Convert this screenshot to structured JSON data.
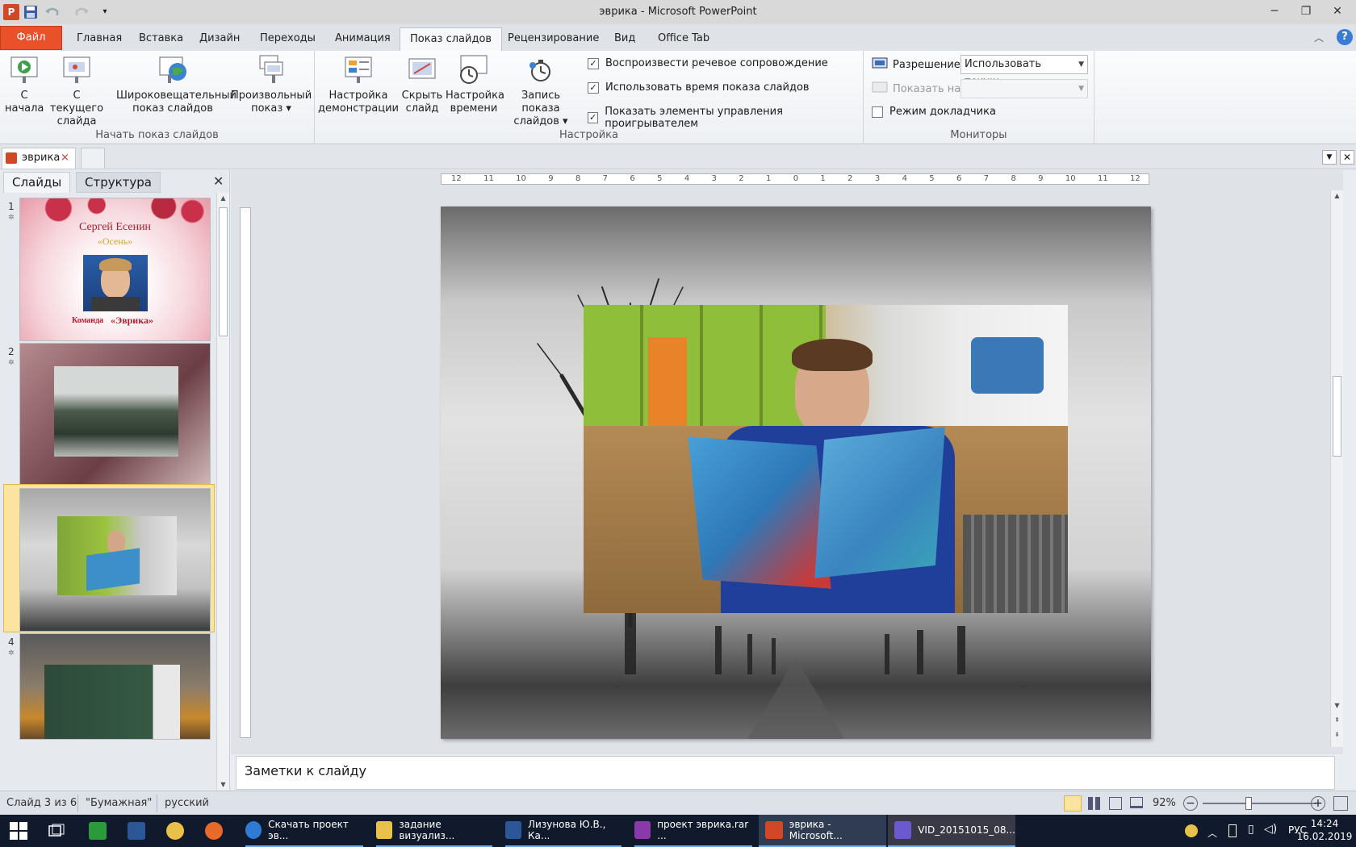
{
  "window": {
    "title": "эврика  -  Microsoft PowerPoint",
    "app_icon_letter": "P"
  },
  "tabs": [
    "Файл",
    "Главная",
    "Вставка",
    "Дизайн",
    "Переходы",
    "Анимация",
    "Показ слайдов",
    "Рецензирование",
    "Вид",
    "Office Tab"
  ],
  "active_tab": "Показ слайдов",
  "ribbon": {
    "start_group": {
      "label": "Начать показ слайдов",
      "from_beginning": [
        "С",
        "начала"
      ],
      "from_current": [
        "С текущего",
        "слайда"
      ],
      "broadcast": [
        "Широковещательный",
        "показ слайдов"
      ],
      "custom": [
        "Произвольный",
        "показ ▾"
      ]
    },
    "setup_group": {
      "label": "Настройка",
      "setup_show": [
        "Настройка",
        "демонстрации"
      ],
      "hide_slide": [
        "Скрыть",
        "слайд"
      ],
      "rehearse": [
        "Настройка",
        "времени"
      ],
      "record": [
        "Запись показа",
        "слайдов ▾"
      ],
      "checkboxes": [
        {
          "label": "Воспроизвести речевое сопровождение",
          "checked": true
        },
        {
          "label": "Использовать время показа слайдов",
          "checked": true
        },
        {
          "label": "Показать элементы управления проигрывателем",
          "checked": true
        }
      ]
    },
    "monitors_group": {
      "label": "Мониторы",
      "resolution_label": "Разрешение:",
      "resolution_value": "Использовать текущ...",
      "show_on_label": "Показать на:",
      "show_on_value": "",
      "presenter_view": {
        "label": "Режим докладчика",
        "checked": false
      }
    }
  },
  "doc_tab": {
    "name": "эврика",
    "close": "×"
  },
  "left_panel": {
    "tabs": [
      "Слайды",
      "Структура"
    ],
    "active": "Слайды",
    "slides": [
      {
        "num": "1",
        "title": "Сергей Есенин",
        "subtitle": "«Осень»",
        "footer_a": "Команда",
        "footer_b": "«Эврика»"
      },
      {
        "num": "2"
      },
      {
        "num": "3",
        "selected": true
      },
      {
        "num": "4"
      }
    ]
  },
  "ruler": {
    "ticks": [
      "12",
      "11",
      "10",
      "9",
      "8",
      "7",
      "6",
      "5",
      "4",
      "3",
      "2",
      "1",
      "0",
      "1",
      "2",
      "3",
      "4",
      "5",
      "6",
      "7",
      "8",
      "9",
      "10",
      "11",
      "12"
    ]
  },
  "notes": {
    "placeholder": "Заметки к слайду"
  },
  "status": {
    "slide_info": "Слайд 3 из 6",
    "theme": "\"Бумажная\"",
    "language": "русский",
    "zoom": "92%"
  },
  "taskbar": {
    "items": [
      {
        "label": "Скачать проект эв...",
        "color": "#2e7bd6"
      },
      {
        "label": "задание визуализ...",
        "color": "#e8c14a"
      },
      {
        "label": "Лизунова Ю.В., Ка...",
        "color": "#2b5797"
      },
      {
        "label": "проект эврика.rar ...",
        "color": "#8a3aa8"
      },
      {
        "label": "эврика - Microsoft...",
        "color": "#d24726"
      },
      {
        "label": "VID_20151015_08...",
        "color": "#6a5acd"
      }
    ],
    "lang": "РУС",
    "time": "14:24",
    "date": "16.02.2019"
  }
}
